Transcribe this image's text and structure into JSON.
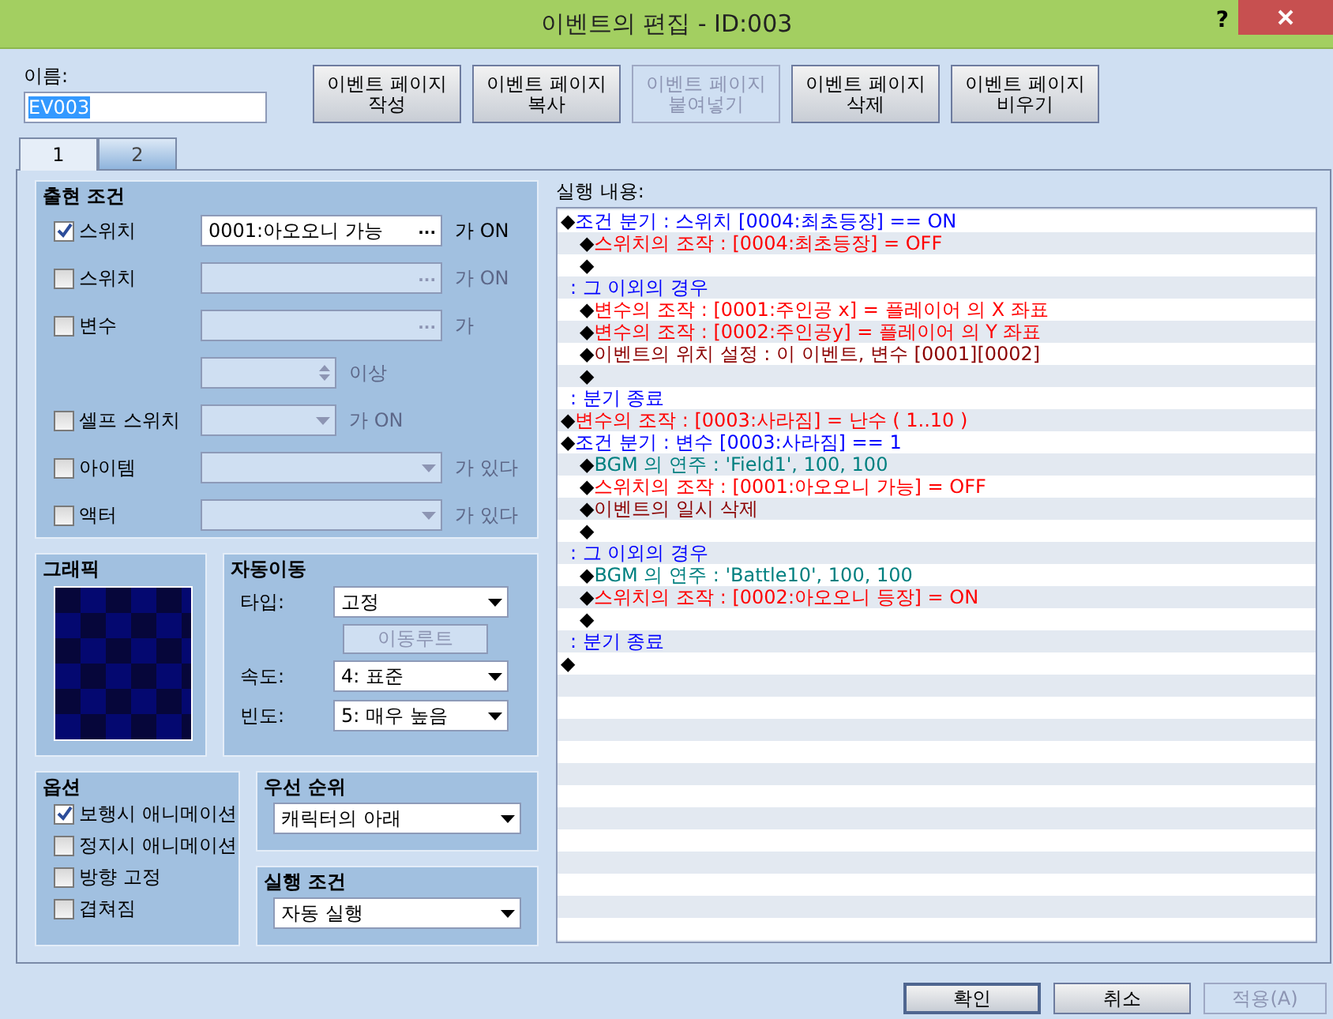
{
  "window": {
    "title": "이벤트의 편집 - ID:003",
    "help": "?"
  },
  "name_field": {
    "label": "이름:",
    "value": "EV003",
    "text_selected": true
  },
  "page_buttons": [
    {
      "label": "이벤트 페이지\n작성",
      "disabled": false
    },
    {
      "label": "이벤트 페이지\n복사",
      "disabled": false
    },
    {
      "label": "이벤트 페이지\n붙여넣기",
      "disabled": true
    },
    {
      "label": "이벤트 페이지\n삭제",
      "disabled": false
    },
    {
      "label": "이벤트 페이지\n비우기",
      "disabled": false
    }
  ],
  "tabs": [
    {
      "label": "1",
      "selected": true
    },
    {
      "label": "2",
      "selected": false
    }
  ],
  "appearance_conditions": {
    "title": "출현 조건",
    "rows": [
      {
        "kind": "picker",
        "label": "스위치",
        "checked": true,
        "value": "0001:아오오니 가능",
        "button": "...",
        "suffix": "가 ON"
      },
      {
        "kind": "picker",
        "label": "스위치",
        "checked": false,
        "button": "...",
        "suffix": "가 ON"
      },
      {
        "kind": "picker",
        "label": "변수",
        "checked": false,
        "button": "...",
        "suffix": "가"
      },
      {
        "kind": "spinner",
        "disabled": true,
        "suffix": "이상"
      },
      {
        "kind": "dropdown",
        "label": "셀프 스위치",
        "checked": false,
        "suffix": "가 ON"
      },
      {
        "kind": "combo",
        "label": "아이템",
        "checked": false,
        "suffix": "가 있다"
      },
      {
        "kind": "combo",
        "label": "액터",
        "checked": false,
        "suffix": "가 있다"
      }
    ]
  },
  "graphic": {
    "title": "그래픽"
  },
  "autonomous_movement": {
    "title": "자동이동",
    "rows": [
      {
        "kind": "combo",
        "label": "타입:",
        "value": "고정"
      },
      {
        "kind": "button",
        "label": "이동루트",
        "disabled": true
      },
      {
        "kind": "combo",
        "label": "속도:",
        "value": "4: 표준"
      },
      {
        "kind": "combo",
        "label": "빈도:",
        "value": "5: 매우 높음"
      }
    ]
  },
  "options": {
    "title": "옵션",
    "items": [
      {
        "label": "보행시 애니메이션",
        "checked": true
      },
      {
        "label": "정지시 애니메이션",
        "checked": false
      },
      {
        "label": "방향 고정",
        "checked": false
      },
      {
        "label": "겹쳐짐",
        "checked": false
      }
    ]
  },
  "priority": {
    "title": "우선 순위",
    "value": "캐릭터의 아래"
  },
  "trigger": {
    "title": "실행 조건",
    "value": "자동 실행"
  },
  "commands": {
    "label": "실행 내용:",
    "rows": [
      {
        "kind": "branch",
        "bullet": "◆",
        "text": "조건 분기 : 스위치 [0004:최초등장] == ON",
        "children": [
          {
            "kind": "operation",
            "bullet": "◆",
            "text": "스위치의 조작 : [0004:최초등장] = OFF"
          },
          {
            "kind": "empty",
            "bullet": "◆"
          }
        ]
      },
      {
        "kind": "branch-label",
        "text": ": 그 이외의 경우",
        "children": [
          {
            "kind": "operation",
            "bullet": "◆",
            "text": "변수의 조작 : [0001:주인공 x] = 플레이어 의 X 좌표"
          },
          {
            "kind": "operation",
            "bullet": "◆",
            "text": "변수의 조작 : [0002:주인공y] = 플레이어 의 Y 좌표"
          },
          {
            "kind": "event",
            "bullet": "◆",
            "text": "이벤트의 위치 설정 : 이 이벤트, 변수 [0001][0002]"
          },
          {
            "kind": "empty",
            "bullet": "◆"
          }
        ]
      },
      {
        "kind": "branch-label",
        "text": ": 분기 종료"
      },
      {
        "kind": "operation",
        "bullet": "◆",
        "text": "변수의 조작 : [0003:사라짐] = 난수 ( 1..10 )"
      },
      {
        "kind": "branch",
        "bullet": "◆",
        "text": "조건 분기 : 변수 [0003:사라짐] == 1",
        "children": [
          {
            "kind": "audio",
            "bullet": "◆",
            "text": "BGM 의 연주 : 'Field1', 100, 100"
          },
          {
            "kind": "operation",
            "bullet": "◆",
            "text": "스위치의 조작 : [0001:아오오니 가능] = OFF"
          },
          {
            "kind": "event",
            "bullet": "◆",
            "text": "이벤트의 일시 삭제"
          },
          {
            "kind": "empty",
            "bullet": "◆"
          }
        ]
      },
      {
        "kind": "branch-label",
        "text": ": 그 이외의 경우",
        "children": [
          {
            "kind": "audio",
            "bullet": "◆",
            "text": "BGM 의 연주 : 'Battle10', 100, 100"
          },
          {
            "kind": "operation",
            "bullet": "◆",
            "text": "스위치의 조작 : [0002:아오오니 등장] = ON"
          },
          {
            "kind": "empty",
            "bullet": "◆"
          }
        ]
      },
      {
        "kind": "branch-label",
        "text": ": 분기 종료"
      },
      {
        "kind": "empty",
        "bullet": "◆"
      }
    ]
  },
  "footer_buttons": [
    {
      "label": "확인",
      "default": true,
      "disabled": false
    },
    {
      "label": "취소",
      "default": false,
      "disabled": false
    },
    {
      "label": "적용(A)",
      "default": false,
      "disabled": true
    }
  ]
}
